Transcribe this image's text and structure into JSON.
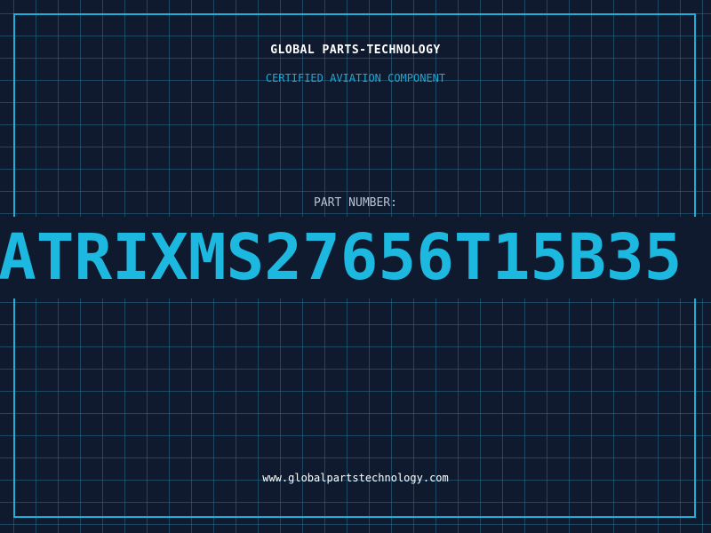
{
  "brand": {
    "name": "GLOBAL PARTS-TECHNOLOGY",
    "tagline": "CERTIFIED AVIATION COMPONENT"
  },
  "part": {
    "label": "PART NUMBER:",
    "number": "ATRIXMS27656T15B35"
  },
  "footer": {
    "website": "www.globalpartstechnology.com"
  },
  "colors": {
    "background": "#0f1a2e",
    "accent": "#1cb8e0",
    "grid": "#286e8c"
  }
}
